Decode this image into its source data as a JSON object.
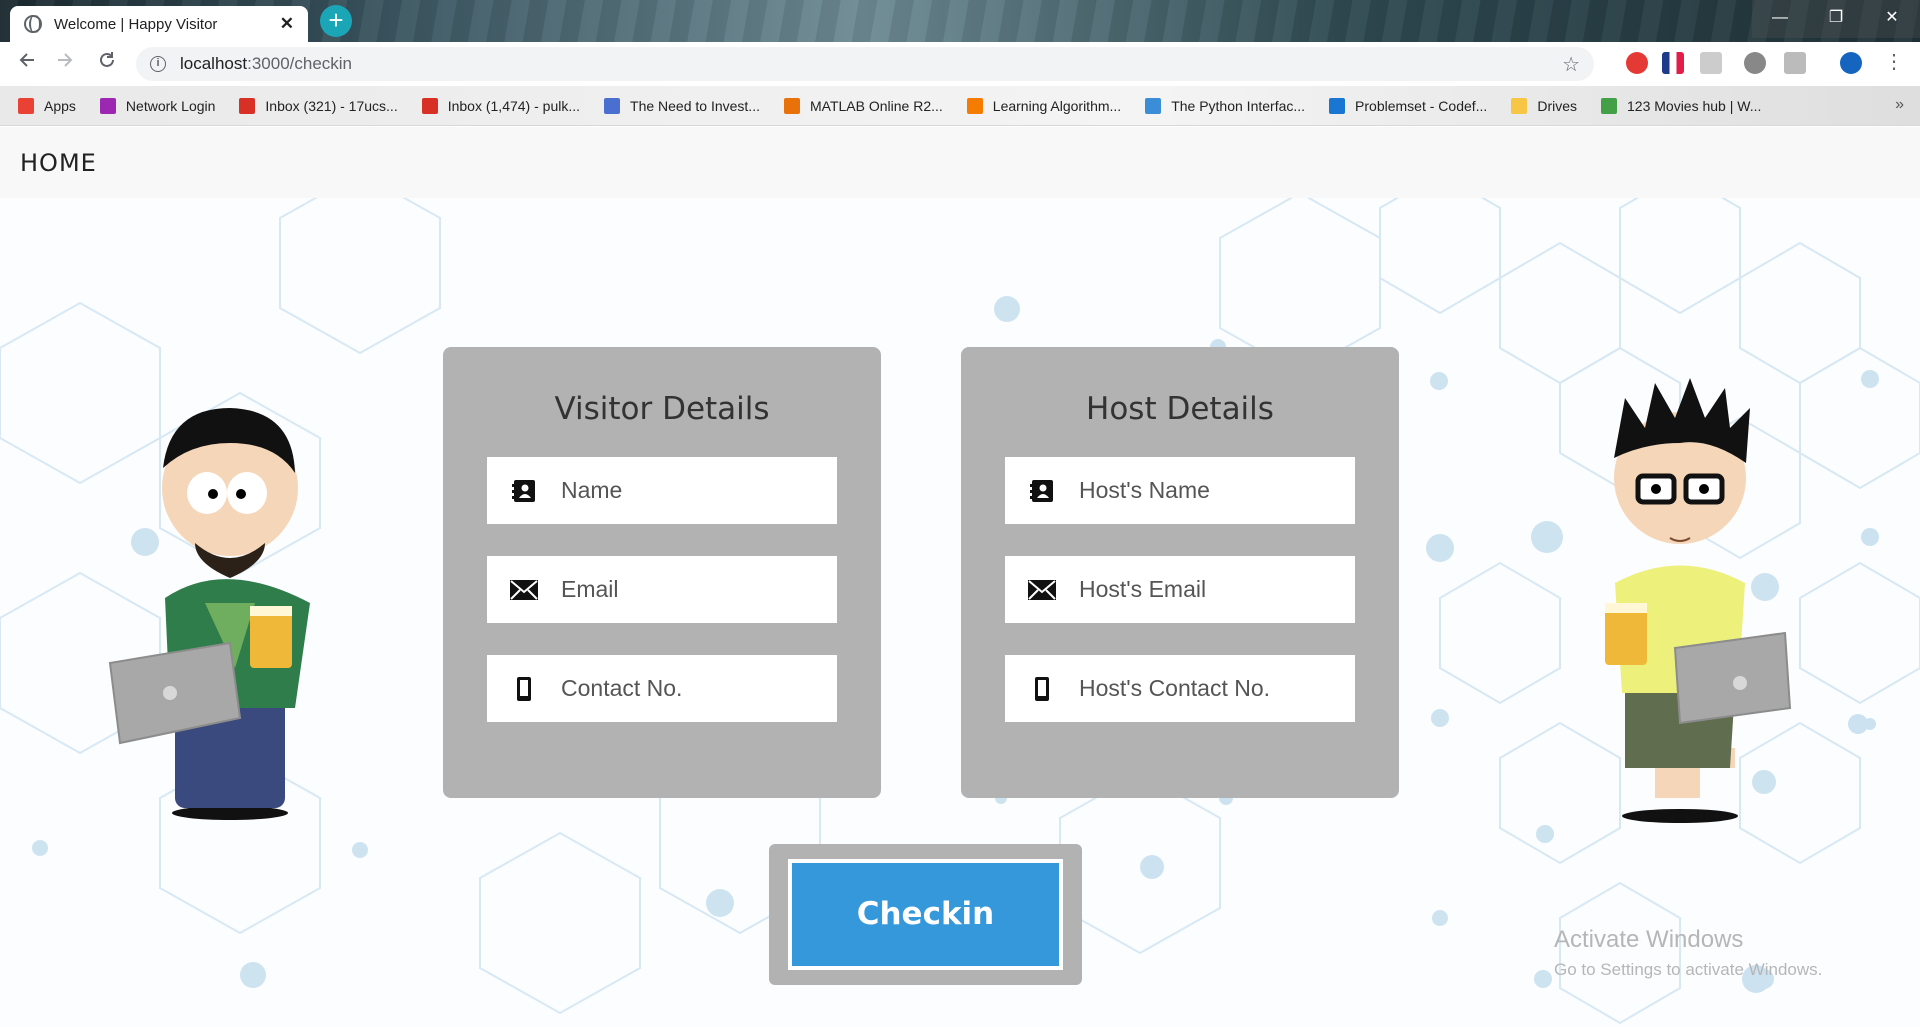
{
  "browser": {
    "tab_title": "Welcome | Happy Visitor",
    "tab_close": "✕",
    "new_tab": "+",
    "url_host": "localhost",
    "url_path": ":3000/checkin",
    "window_controls": {
      "minimize": "—",
      "maximize": "❐",
      "close": "✕"
    }
  },
  "bookmarks": [
    {
      "label": "Apps",
      "color": "#e94235"
    },
    {
      "label": "Network Login",
      "color": "#9c27b0"
    },
    {
      "label": "Inbox (321) - 17ucs...",
      "color": "#d93025"
    },
    {
      "label": "Inbox (1,474) - pulk...",
      "color": "#d93025"
    },
    {
      "label": "The Need to Invest...",
      "color": "#4a6fd1"
    },
    {
      "label": "MATLAB Online R2...",
      "color": "#e8710a"
    },
    {
      "label": "Learning Algorithm...",
      "color": "#f57c00"
    },
    {
      "label": "The Python Interfac...",
      "color": "#3c8dd8"
    },
    {
      "label": "Problemset - Codef...",
      "color": "#1976d2"
    },
    {
      "label": "Drives",
      "color": "#f6c644"
    },
    {
      "label": "123 Movies hub | W...",
      "color": "#43a047"
    }
  ],
  "bookmarks_more": "»",
  "page": {
    "nav_home": "HOME",
    "visitor": {
      "title": "Visitor Details",
      "name_placeholder": "Name",
      "email_placeholder": "Email",
      "contact_placeholder": "Contact No."
    },
    "host": {
      "title": "Host Details",
      "name_placeholder": "Host's Name",
      "email_placeholder": "Host's Email",
      "contact_placeholder": "Host's Contact No."
    },
    "checkin_label": "Checkin",
    "accent_color": "#3498db",
    "card_color": "#b2b2b2"
  },
  "watermark": {
    "line1": "Activate Windows",
    "line2": "Go to Settings to activate Windows."
  }
}
